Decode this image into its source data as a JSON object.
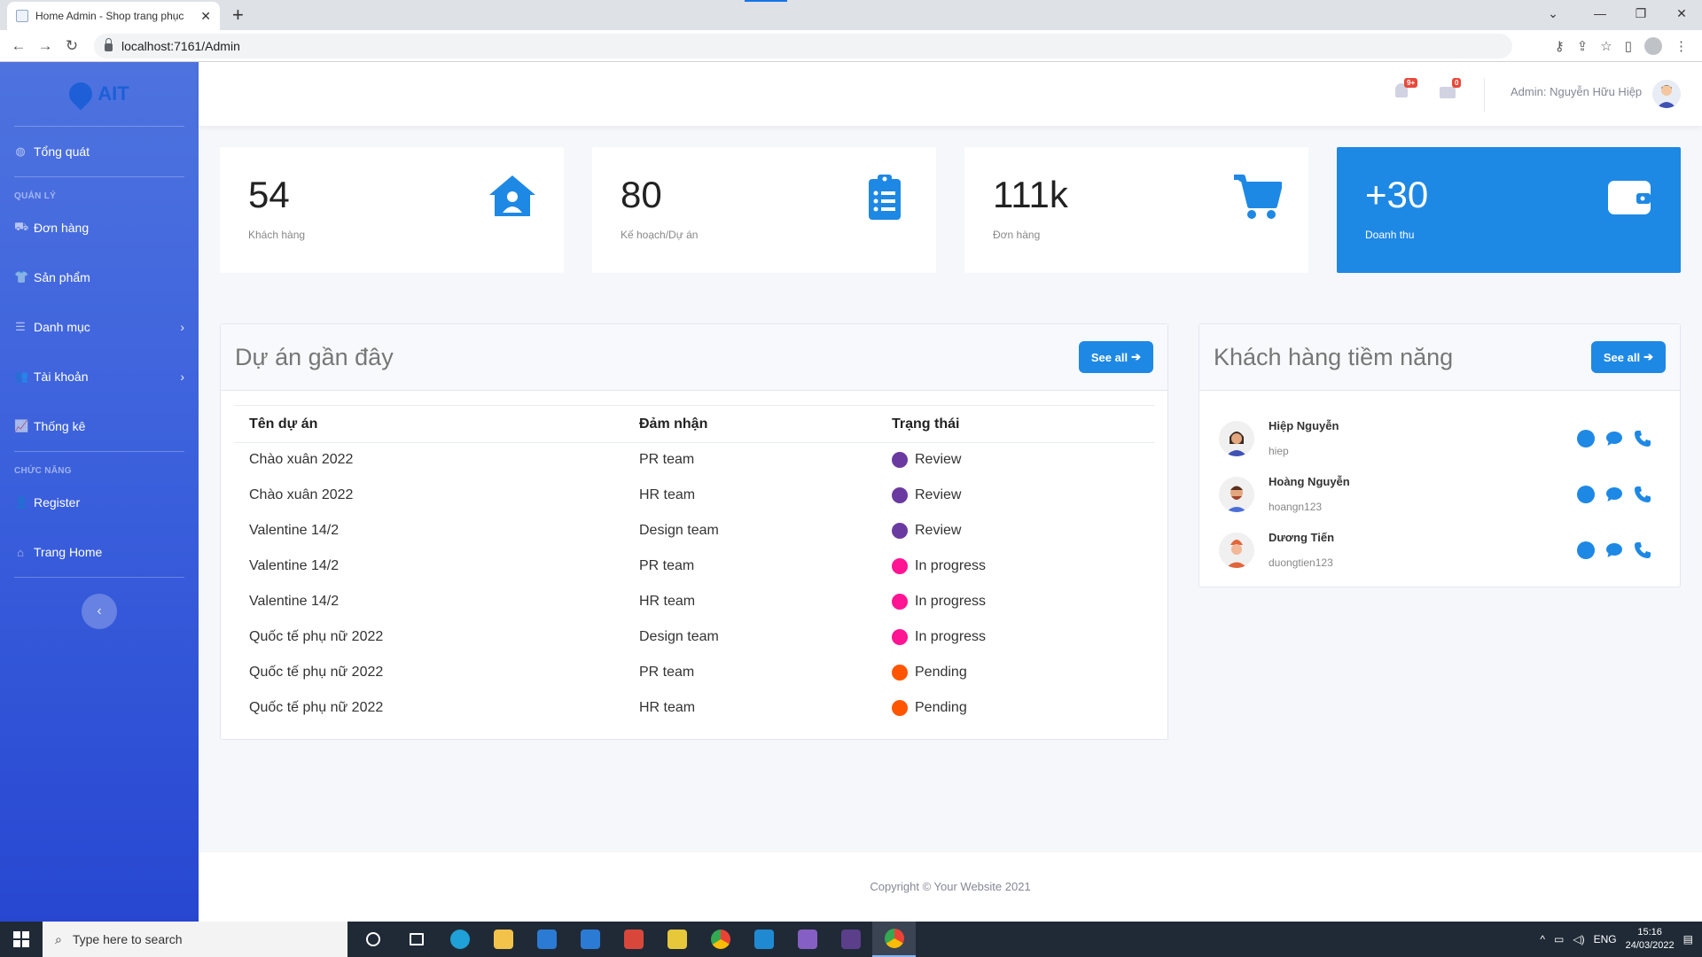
{
  "browser": {
    "tab_title": "Home Admin - Shop trang phục",
    "url": "localhost:7161/Admin"
  },
  "sidebar": {
    "brand": "AIT",
    "overview": "Tổng quát",
    "heading_manage": "QUẢN LÝ",
    "orders": "Đơn hàng",
    "products": "Sản phẩm",
    "categories": "Danh mục",
    "accounts": "Tài khoản",
    "stats": "Thống kê",
    "heading_functions": "CHỨC NĂNG",
    "register": "Register",
    "home": "Trang Home"
  },
  "topbar": {
    "alerts_badge": "9+",
    "messages_badge": "0",
    "user_label": "Admin: Nguyễn Hữu Hiệp"
  },
  "stats": [
    {
      "value": "54",
      "label": "Khách hàng",
      "icon": "house-user-icon"
    },
    {
      "value": "80",
      "label": "Kế hoạch/Dự án",
      "icon": "clipboard-list-icon"
    },
    {
      "value": "111k",
      "label": "Đơn hàng",
      "icon": "cart-icon"
    },
    {
      "value": "+30",
      "label": "Doanh thu",
      "icon": "wallet-icon"
    }
  ],
  "projects": {
    "title": "Dự án gần đây",
    "see_all": "See all",
    "columns": [
      "Tên dự án",
      "Đảm nhận",
      "Trạng thái"
    ],
    "rows": [
      {
        "name": "Chào xuân 2022",
        "team": "PR team",
        "status": "Review",
        "color": "#6a3aa0"
      },
      {
        "name": "Chào xuân 2022",
        "team": "HR team",
        "status": "Review",
        "color": "#6a3aa0"
      },
      {
        "name": "Valentine 14/2",
        "team": "Design team",
        "status": "Review",
        "color": "#6a3aa0"
      },
      {
        "name": "Valentine 14/2",
        "team": "PR team",
        "status": "In progress",
        "color": "#ff1493"
      },
      {
        "name": "Valentine 14/2",
        "team": "HR team",
        "status": "In progress",
        "color": "#ff1493"
      },
      {
        "name": "Quốc tế phụ nữ 2022",
        "team": "Design team",
        "status": "In progress",
        "color": "#ff1493"
      },
      {
        "name": "Quốc tế phụ nữ 2022",
        "team": "PR team",
        "status": "Pending",
        "color": "#ff5500"
      },
      {
        "name": "Quốc tế phụ nữ 2022",
        "team": "HR team",
        "status": "Pending",
        "color": "#ff5500"
      }
    ]
  },
  "customers": {
    "title": "Khách hàng tiềm năng",
    "see_all": "See all",
    "items": [
      {
        "name": "Hiệp Nguyễn",
        "username": "hiep"
      },
      {
        "name": "Hoàng Nguyễn",
        "username": "hoangn123"
      },
      {
        "name": "Dương Tiến",
        "username": "duongtien123"
      }
    ]
  },
  "footer": "Copyright © Your Website 2021",
  "taskbar": {
    "search_placeholder": "Type here to search",
    "lang": "ENG",
    "time": "15:16",
    "date": "24/03/2022"
  },
  "colors": {
    "accent": "#1e88e5",
    "sidebar": "#4e73df"
  }
}
